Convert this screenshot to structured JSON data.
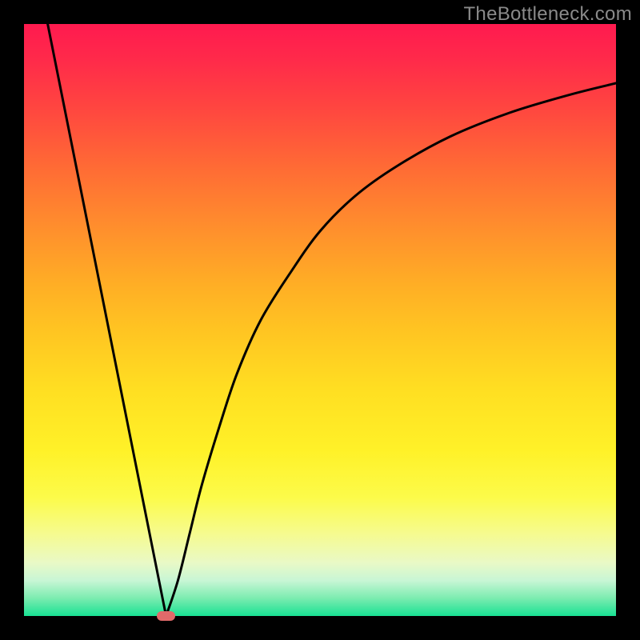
{
  "watermark": "TheBottleneck.com",
  "chart_data": {
    "type": "line",
    "title": "",
    "xlabel": "",
    "ylabel": "",
    "xlim": [
      0,
      100
    ],
    "ylim": [
      0,
      100
    ],
    "grid": false,
    "legend": false,
    "series": [
      {
        "name": "left-line",
        "x": [
          4,
          24
        ],
        "values": [
          100,
          0
        ]
      },
      {
        "name": "right-curve",
        "x": [
          24,
          26,
          28,
          30,
          33,
          36,
          40,
          45,
          50,
          56,
          63,
          72,
          82,
          92,
          100
        ],
        "values": [
          0,
          6,
          14,
          22,
          32,
          41,
          50,
          58,
          65,
          71,
          76,
          81,
          85,
          88,
          90
        ]
      }
    ],
    "marker": {
      "x": 24,
      "y": 0,
      "w": 3.2,
      "h": 1.6
    }
  },
  "plot": {
    "left": 30,
    "top": 30,
    "size": 740
  }
}
